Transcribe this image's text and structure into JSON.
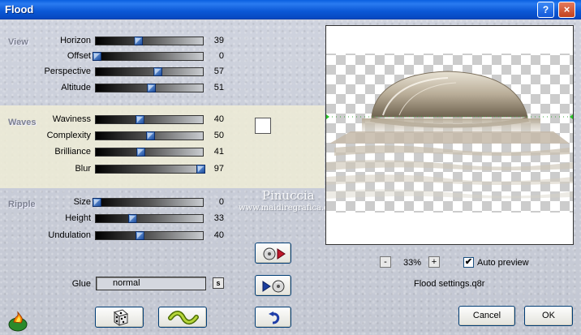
{
  "window": {
    "title": "Flood",
    "help_glyph": "?",
    "close_glyph": "×"
  },
  "sections": {
    "view": "View",
    "waves": "Waves",
    "ripple": "Ripple"
  },
  "sliders": [
    {
      "label": "Horizon",
      "value": "39",
      "fraction": 0.39
    },
    {
      "label": "Offset",
      "value": "0",
      "fraction": 0.0
    },
    {
      "label": "Perspective",
      "value": "57",
      "fraction": 0.57
    },
    {
      "label": "Altitude",
      "value": "51",
      "fraction": 0.51
    },
    {
      "label": "Waviness",
      "value": "40",
      "fraction": 0.4
    },
    {
      "label": "Complexity",
      "value": "50",
      "fraction": 0.5
    },
    {
      "label": "Brilliance",
      "value": "41",
      "fraction": 0.41
    },
    {
      "label": "Blur",
      "value": "97",
      "fraction": 0.97
    },
    {
      "label": "Size",
      "value": "0",
      "fraction": 0.0
    },
    {
      "label": "Height",
      "value": "33",
      "fraction": 0.33
    },
    {
      "label": "Undulation",
      "value": "40",
      "fraction": 0.4
    }
  ],
  "wave_color": "#ffffff",
  "glue": {
    "label": "Glue",
    "value": "normal",
    "s_button": "s"
  },
  "watermark": {
    "name": "Pinuccia",
    "url": "www.maidiregrafica.eu"
  },
  "preview": {
    "zoom": "33%",
    "minus": "-",
    "plus": "+",
    "auto_preview_label": "Auto preview",
    "auto_preview_checked": true,
    "check_glyph": "✔"
  },
  "settings_file": "Flood settings.q8r",
  "buttons": {
    "cancel": "Cancel",
    "ok": "OK"
  },
  "icons": {
    "logo": "flame-logo-icon",
    "random": "dice-icon",
    "reset": "wave-reset-icon",
    "load": "load-settings-icon",
    "save": "save-settings-icon",
    "undo": "undo-icon"
  },
  "colors": {
    "accent": "#0a5fe0",
    "band": "#eeecd6",
    "liquid": "#c8bfb0"
  }
}
